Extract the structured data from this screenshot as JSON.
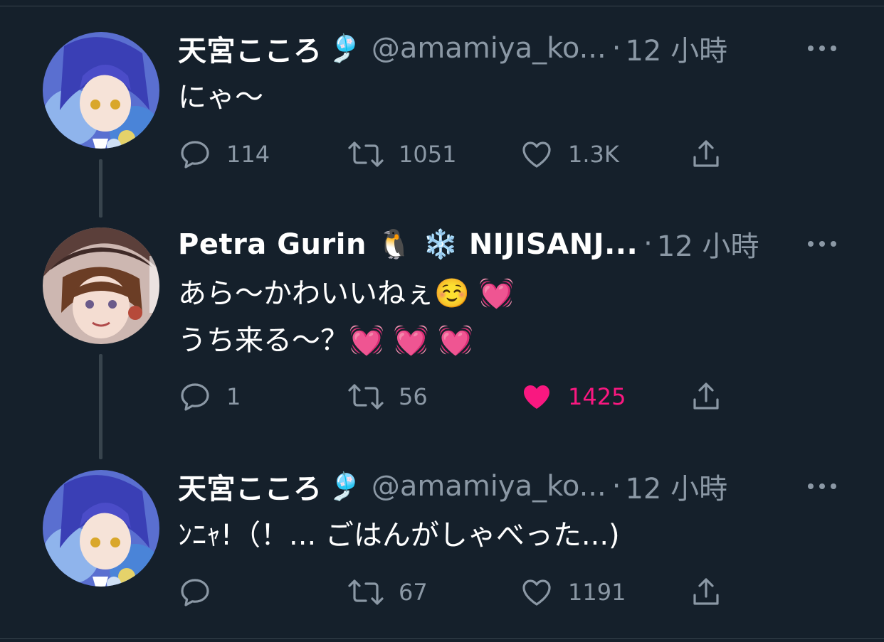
{
  "colors": {
    "background": "#15202b",
    "secondary_text": "#8b98a5",
    "like_active": "#f91880",
    "thread_line": "#38444d"
  },
  "tweets": [
    {
      "name": "天宮こころ",
      "badge": "🎐",
      "handle": "@amamiya_ko...",
      "dot": "·",
      "time": "12 小時",
      "text": "にゃ～",
      "replies": "114",
      "retweets": "1051",
      "likes": "1.3K",
      "liked": false,
      "avatar_icon": "avatar-kokoro"
    },
    {
      "name": "Petra Gurin 🐧 ❄️ NIJISANJ...",
      "badge": "",
      "handle": "",
      "dot": "·",
      "time": "12 小時",
      "text": "あら～かわいいねぇ☺️ 💓\nうち来る～？💓 💓 💓",
      "replies": "1",
      "retweets": "56",
      "likes": "1425",
      "liked": true,
      "avatar_icon": "avatar-petra"
    },
    {
      "name": "天宮こころ",
      "badge": "🎐",
      "handle": "@amamiya_ko...",
      "dot": "·",
      "time": "12 小時",
      "text": "ﾝﾆｬ!（！... ごはんがしゃべった...)",
      "replies": "",
      "retweets": "67",
      "likes": "1191",
      "liked": false,
      "avatar_icon": "avatar-kokoro"
    }
  ]
}
